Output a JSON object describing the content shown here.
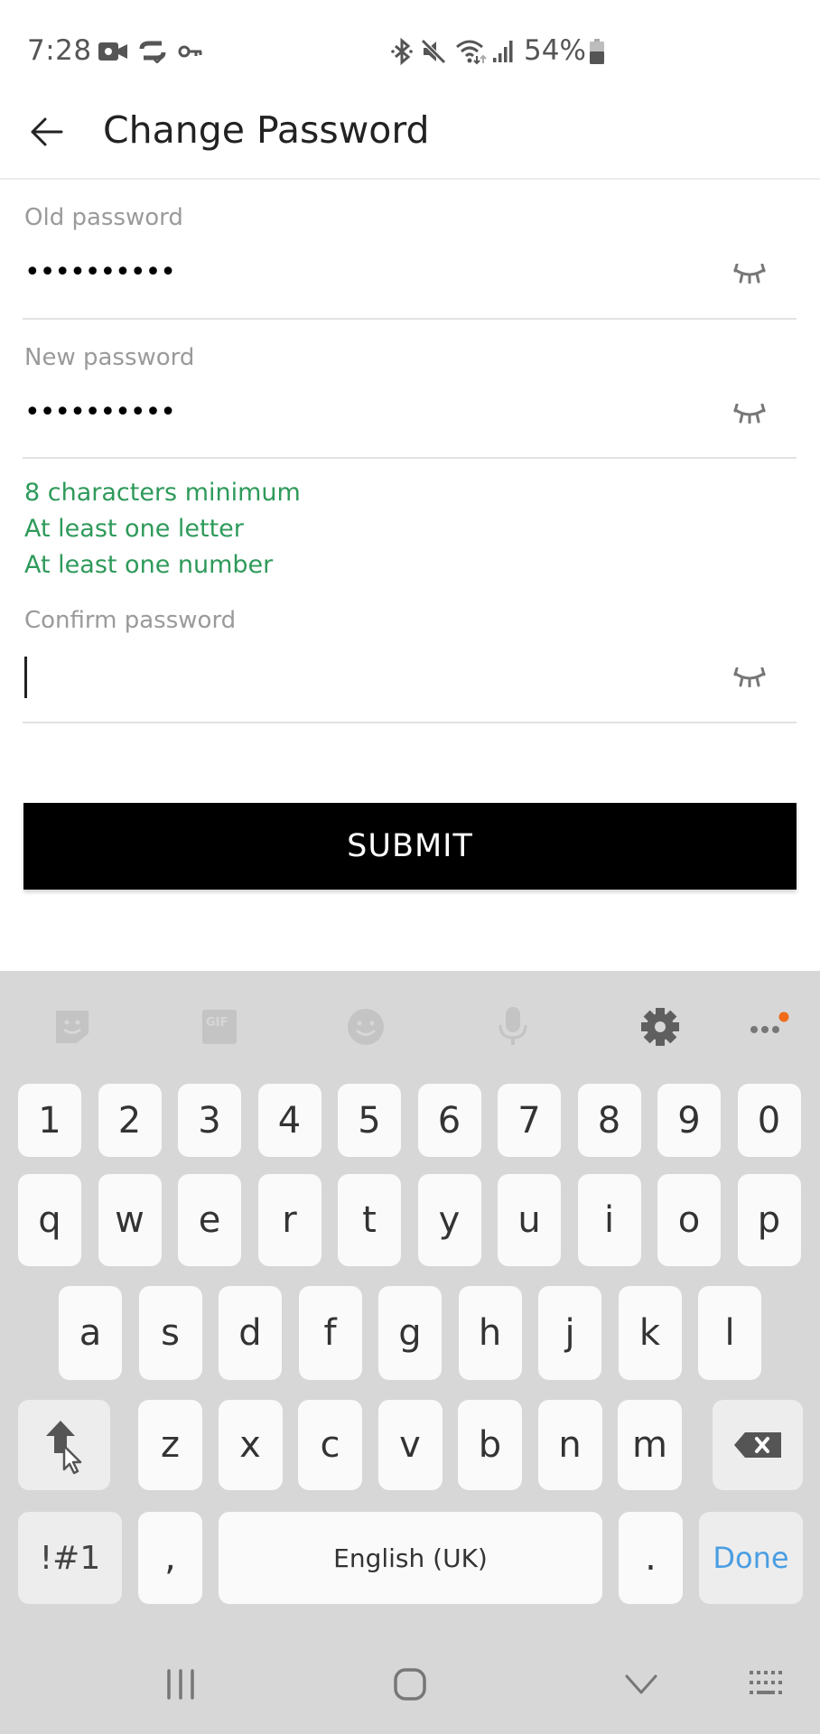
{
  "status_bar": {
    "time": "7:28",
    "battery_percent": "54%",
    "left_icons": [
      "video-camera-icon",
      "sync-icon",
      "vpn-key-icon"
    ],
    "right_icons": [
      "bluetooth-icon",
      "mute-icon",
      "wifi-icon",
      "signal-icon",
      "battery-icon"
    ]
  },
  "header": {
    "title": "Change Password",
    "back_icon": "arrow-left-icon"
  },
  "form": {
    "old_password": {
      "label": "Old password",
      "value": "••••••••••",
      "toggle_icon": "eye-closed-icon"
    },
    "new_password": {
      "label": "New password",
      "value": "••••••••••",
      "toggle_icon": "eye-closed-icon"
    },
    "requirements": [
      "8 characters minimum",
      "At least one letter",
      "At least one number"
    ],
    "confirm_password": {
      "label": "Confirm password",
      "value": "",
      "toggle_icon": "eye-closed-icon"
    },
    "submit_label": "SUBMIT"
  },
  "colors": {
    "hint_green": "#2e9a5a",
    "done_blue": "#4a9ee2",
    "badge_orange": "#f06a1a",
    "keyboard_bg": "#d7d7d7"
  },
  "keyboard": {
    "toolbar": [
      "sticker-icon",
      "gif-icon",
      "emoji-icon",
      "microphone-icon",
      "settings-icon",
      "more-icon"
    ],
    "gif_label": "GIF",
    "row1": [
      "1",
      "2",
      "3",
      "4",
      "5",
      "6",
      "7",
      "8",
      "9",
      "0"
    ],
    "row2": [
      "q",
      "w",
      "e",
      "r",
      "t",
      "y",
      "u",
      "i",
      "o",
      "p"
    ],
    "row3": [
      "a",
      "s",
      "d",
      "f",
      "g",
      "h",
      "j",
      "k",
      "l"
    ],
    "row4": [
      "z",
      "x",
      "c",
      "v",
      "b",
      "n",
      "m"
    ],
    "symbols_label": "!#1",
    "comma_label": ",",
    "space_label": "English (UK)",
    "period_label": ".",
    "done_label": "Done"
  },
  "nav_bar": [
    "recent-apps-icon",
    "home-icon",
    "hide-keyboard-icon",
    "keyboard-switch-icon"
  ]
}
